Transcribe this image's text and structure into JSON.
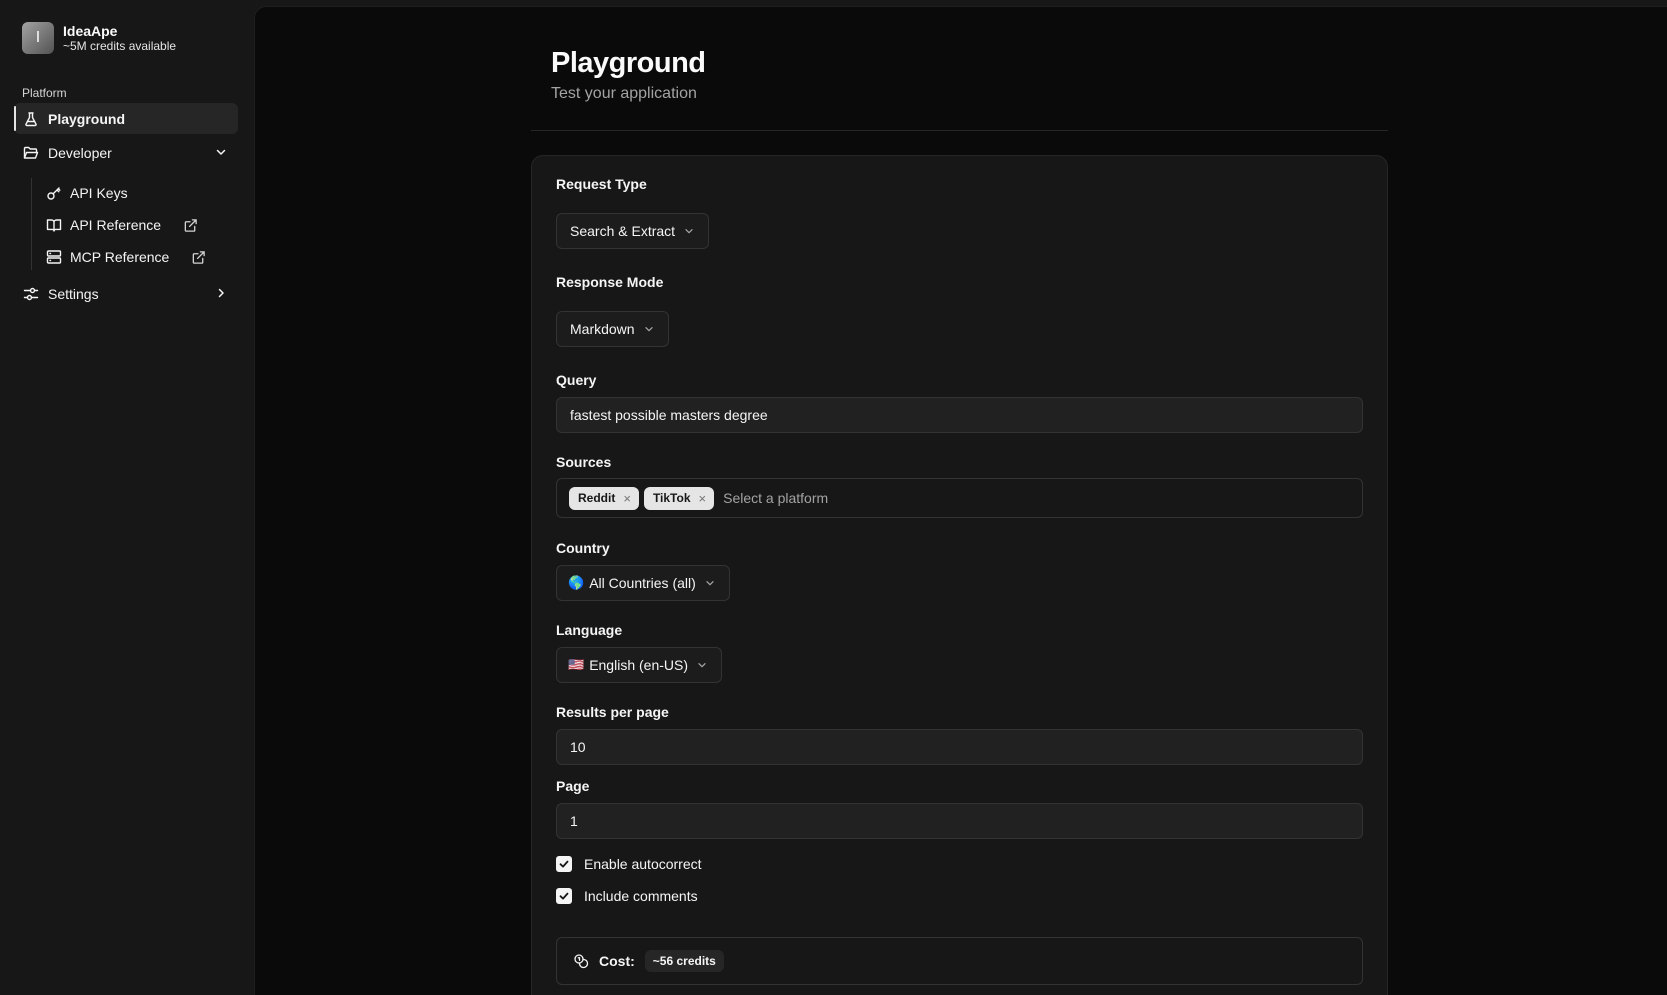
{
  "brand": {
    "initial": "I",
    "name": "IdeaApe",
    "credits": "~5M credits available"
  },
  "sidebar": {
    "section_label": "Platform",
    "items": [
      {
        "label": "Playground",
        "icon": "flask-icon",
        "active": true
      },
      {
        "label": "Developer",
        "icon": "folder-open-icon",
        "expanded": true
      },
      {
        "label": "Settings",
        "icon": "sliders-icon"
      }
    ],
    "developer_children": [
      {
        "label": "API Keys",
        "icon": "key-icon"
      },
      {
        "label": "API Reference",
        "icon": "book-icon",
        "external": true
      },
      {
        "label": "MCP Reference",
        "icon": "server-icon",
        "external": true
      }
    ]
  },
  "header": {
    "title": "Playground",
    "subtitle": "Test your application"
  },
  "form": {
    "request_type": {
      "label": "Request Type",
      "value": "Search & Extract"
    },
    "response_mode": {
      "label": "Response Mode",
      "value": "Markdown"
    },
    "query": {
      "label": "Query",
      "value": "fastest possible masters degree"
    },
    "sources": {
      "label": "Sources",
      "tags": [
        "Reddit",
        "TikTok"
      ],
      "placeholder": "Select a platform",
      "remove_glyph": "×"
    },
    "country": {
      "label": "Country",
      "flag": "🌎",
      "value": "All Countries (all)"
    },
    "language": {
      "label": "Language",
      "flag": "🇺🇸",
      "value": "English (en-US)"
    },
    "results_per_page": {
      "label": "Results per page",
      "value": "10"
    },
    "page": {
      "label": "Page",
      "value": "1"
    },
    "autocorrect": {
      "label": "Enable autocorrect",
      "checked": true
    },
    "comments": {
      "label": "Include comments",
      "checked": true
    },
    "cost": {
      "label": "Cost:",
      "value": "~56 credits"
    }
  },
  "colors": {
    "background": "#0a0a0a",
    "sidebar": "#171717",
    "card": "#171717",
    "border": "#333333",
    "text": "#f5f5f5",
    "muted": "#a3a3a3"
  }
}
